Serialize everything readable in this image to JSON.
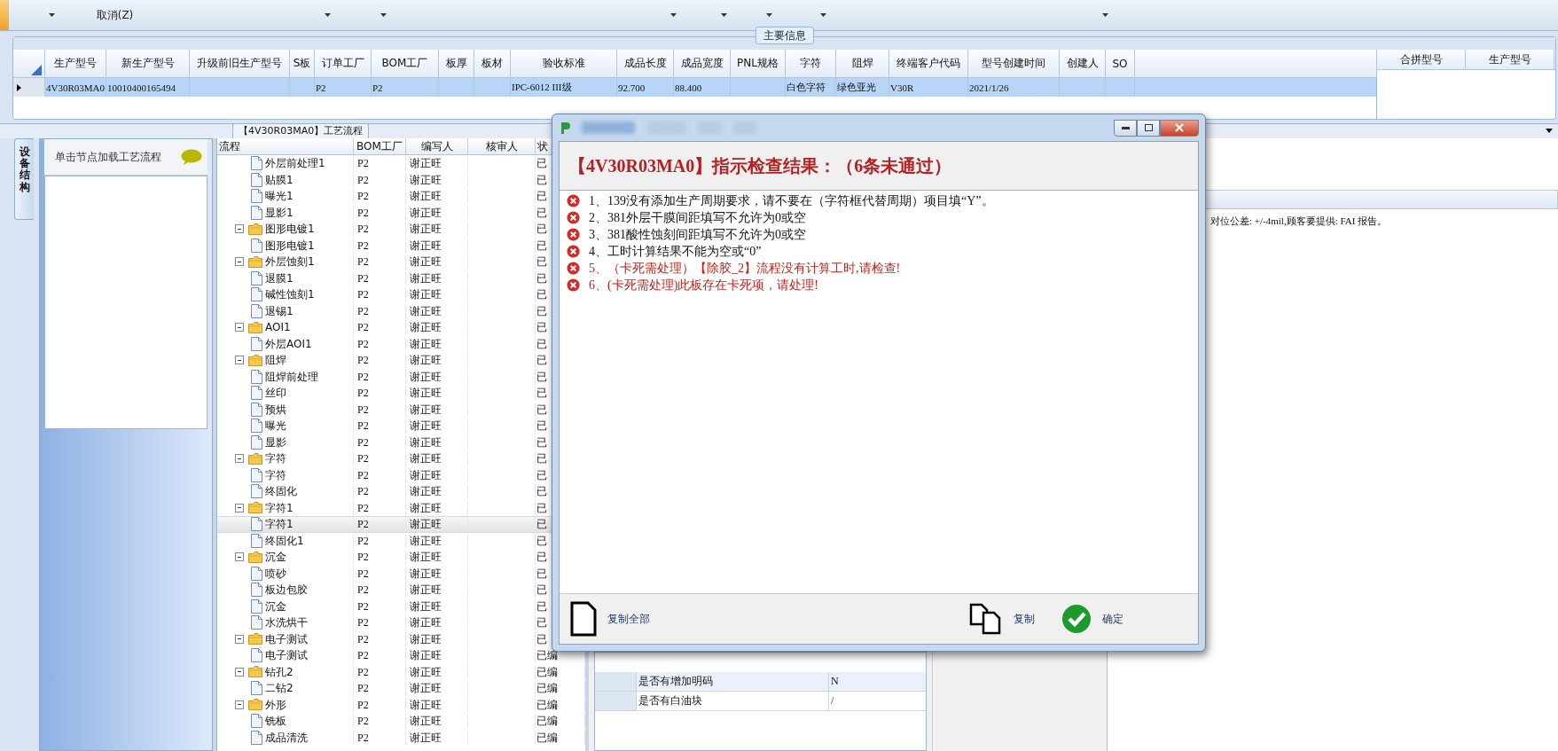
{
  "toolbar": {
    "items": [
      {
        "label": "取消(Z)"
      }
    ]
  },
  "main_info": {
    "title": "主要信息",
    "columns": [
      "生产型号",
      "新生产型号",
      "升级前旧生产型号",
      "S板",
      "订单工厂",
      "BOM工厂",
      "板厚",
      "板材",
      "验收标准",
      "成品长度",
      "成品宽度",
      "PNL规格",
      "字符",
      "阻焊",
      "终端客户代码",
      "型号创建时间",
      "创建人",
      "SO"
    ],
    "rows": [
      {
        "selected": true,
        "cells": [
          "4V30R03MA0",
          "10010400165494",
          null,
          null,
          "P2",
          "P2",
          null,
          null,
          "IPC-6012 III级",
          "92.700",
          "88.400",
          null,
          "白色字符",
          "绿色亚光",
          "V30R",
          "2021/1/26",
          null,
          null
        ]
      }
    ],
    "side_table": {
      "columns": [
        "合拼型号",
        "生产型号"
      ]
    }
  },
  "process": {
    "title": "【4V30R03MA0】工艺流程",
    "left_tab": "设备结构",
    "hint": "单击节点加载工艺流程",
    "tree": {
      "columns": [
        "流程",
        "BOM工厂",
        "编写人",
        "核审人",
        "状"
      ],
      "nodes": [
        {
          "children": [
            {
              "label": "外层前处理1",
              "bom": "P2",
              "author": "谢正旺",
              "status": "已",
              "selected": false
            },
            {
              "label": "贴膜1",
              "bom": "P2",
              "author": "谢正旺",
              "status": "已",
              "selected": false
            },
            {
              "label": "曝光1",
              "bom": "P2",
              "author": "谢正旺",
              "status": "已",
              "selected": false
            },
            {
              "label": "显影1",
              "bom": "P2",
              "author": "谢正旺",
              "status": "已",
              "selected": false
            }
          ]
        },
        {
          "label": "图形电镀1",
          "bom": "P2",
          "author": "谢正旺",
          "status": "已",
          "selected": false,
          "expanded": true,
          "children": [
            {
              "label": "图形电镀1",
              "bom": "P2",
              "author": "谢正旺",
              "status": "已",
              "selected": false
            }
          ]
        },
        {
          "label": "外层蚀刻1",
          "bom": "P2",
          "author": "谢正旺",
          "status": "已",
          "selected": false,
          "expanded": true,
          "children": [
            {
              "label": "退膜1",
              "bom": "P2",
              "author": "谢正旺",
              "status": "已",
              "selected": false
            },
            {
              "label": "碱性蚀刻1",
              "bom": "P2",
              "author": "谢正旺",
              "status": "已",
              "selected": false
            },
            {
              "label": "退锡1",
              "bom": "P2",
              "author": "谢正旺",
              "status": "已",
              "selected": false
            }
          ]
        },
        {
          "label": "AOI1",
          "bom": "P2",
          "author": "谢正旺",
          "status": "已",
          "selected": false,
          "expanded": true,
          "children": [
            {
              "label": "外层AOI1",
              "bom": "P2",
              "author": "谢正旺",
              "status": "已",
              "selected": false
            }
          ]
        },
        {
          "label": "阻焊",
          "bom": "P2",
          "author": "谢正旺",
          "status": "已",
          "selected": false,
          "expanded": true,
          "children": [
            {
              "label": "阻焊前处理",
              "bom": "P2",
              "author": "谢正旺",
              "status": "已",
              "selected": false
            },
            {
              "label": "丝印",
              "bom": "P2",
              "author": "谢正旺",
              "status": "已",
              "selected": false
            },
            {
              "label": "预烘",
              "bom": "P2",
              "author": "谢正旺",
              "status": "已",
              "selected": false
            },
            {
              "label": "曝光",
              "bom": "P2",
              "author": "谢正旺",
              "status": "已",
              "selected": false
            },
            {
              "label": "显影",
              "bom": "P2",
              "author": "谢正旺",
              "status": "已",
              "selected": false
            }
          ]
        },
        {
          "label": "字符",
          "bom": "P2",
          "author": "谢正旺",
          "status": "已",
          "selected": false,
          "expanded": true,
          "children": [
            {
              "label": "字符",
              "bom": "P2",
              "author": "谢正旺",
              "status": "已",
              "selected": false
            },
            {
              "label": "终固化",
              "bom": "P2",
              "author": "谢正旺",
              "status": "已",
              "selected": false
            }
          ]
        },
        {
          "label": "字符1",
          "bom": "P2",
          "author": "谢正旺",
          "status": "已",
          "selected": false,
          "expanded": true,
          "children": [
            {
              "label": "字符1",
              "bom": "P2",
              "author": "谢正旺",
              "status": "已",
              "selected": true
            },
            {
              "label": "终固化1",
              "bom": "P2",
              "author": "谢正旺",
              "status": "已",
              "selected": false
            }
          ]
        },
        {
          "label": "沉金",
          "bom": "P2",
          "author": "谢正旺",
          "status": "已",
          "selected": false,
          "expanded": true,
          "children": [
            {
              "label": "喷砂",
              "bom": "P2",
              "author": "谢正旺",
              "status": "已",
              "selected": false
            },
            {
              "label": "板边包胶",
              "bom": "P2",
              "author": "谢正旺",
              "status": "已",
              "selected": false
            },
            {
              "label": "沉金",
              "bom": "P2",
              "author": "谢正旺",
              "status": "已",
              "selected": false
            },
            {
              "label": "水洗烘干",
              "bom": "P2",
              "author": "谢正旺",
              "status": "已",
              "selected": false
            }
          ]
        },
        {
          "label": "电子测试",
          "bom": "P2",
          "author": "谢正旺",
          "status": "已",
          "selected": false,
          "expanded": true,
          "children": [
            {
              "label": "电子测试",
              "bom": "P2",
              "author": "谢正旺",
              "status": "已编",
              "selected": false
            }
          ]
        },
        {
          "label": "钻孔2",
          "bom": "P2",
          "author": "谢正旺",
          "status": "已编",
          "selected": false,
          "expanded": true,
          "children": [
            {
              "label": "二钻2",
              "bom": "P2",
              "author": "谢正旺",
              "status": "已编",
              "selected": false
            }
          ]
        },
        {
          "label": "外形",
          "bom": "P2",
          "author": "谢正旺",
          "status": "已编",
          "selected": false,
          "expanded": true,
          "children": [
            {
              "label": "铣板",
              "bom": "P2",
              "author": "谢正旺",
              "status": "已编",
              "selected": false
            },
            {
              "label": "成品清洗",
              "bom": "P2",
              "author": "谢正旺",
              "status": "已编",
              "selected": false
            }
          ]
        }
      ]
    }
  },
  "properties": {
    "rows": [
      {
        "name": "是否有增加明码",
        "value": "N"
      },
      {
        "name": "是否有白油块",
        "value": "/"
      }
    ]
  },
  "note": "对位公差: +/-4mil,顾客要提供: FAI 报告。",
  "dialog": {
    "title_tabs": [
      {
        "selected": true
      },
      {
        "selected": false
      },
      {
        "selected": false
      },
      {
        "selected": false
      }
    ],
    "heading": "【4V30R03MA0】指示检查结果：（6条未通过）",
    "messages": [
      {
        "text": "1、139没有添加生产周期要求，请不要在（字符框代替周期）项目填“Y”。",
        "kind": "error"
      },
      {
        "text": "2、381外层干膜间距填写不允许为0或空",
        "kind": "error"
      },
      {
        "text": "3、381酸性蚀刻间距填写不允许为0或空",
        "kind": "error"
      },
      {
        "text": "4、工时计算结果不能为空或“0”",
        "kind": "error"
      },
      {
        "text": "5、（卡死需处理）【除胶_2】流程没有计算工时,请检查!",
        "kind": "blocking"
      },
      {
        "text": "6、(卡死需处理)此板存在卡死项，请处理!",
        "kind": "blocking"
      }
    ],
    "buttons": [
      {
        "label": "复制全部",
        "kind": "copy_all"
      },
      {
        "label": "复制",
        "kind": "copy"
      },
      {
        "label": "确定",
        "kind": "ok"
      }
    ]
  }
}
